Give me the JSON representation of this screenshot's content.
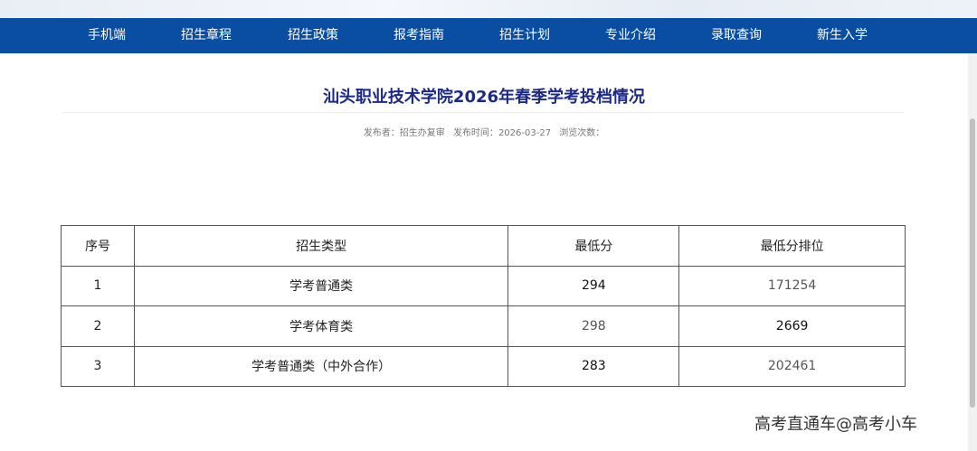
{
  "nav": {
    "items": [
      "手机端",
      "招生章程",
      "招生政策",
      "报考指南",
      "招生计划",
      "专业介绍",
      "录取查询",
      "新生入学"
    ]
  },
  "article": {
    "title": "汕头职业技术学院2026年春季学考投档情况",
    "meta": {
      "publisher_label": "发布者：",
      "publisher": "招生办复审",
      "time_label": "发布时间：",
      "time": "2026-03-27",
      "views_label": "浏览次数："
    }
  },
  "table": {
    "headers": [
      "序号",
      "招生类型",
      "最低分",
      "最低分排位"
    ],
    "rows": [
      [
        "1",
        "学考普通类",
        "294",
        "171254"
      ],
      [
        "2",
        "学考体育类",
        "298",
        "2669"
      ],
      [
        "3",
        "学考普通类（中外合作）",
        "283",
        "202461"
      ]
    ]
  },
  "watermark": "高考直通车@高考小车",
  "colors": {
    "nav_bg": "#0a4ea3",
    "title": "#1c2a86",
    "border": "#555555"
  }
}
